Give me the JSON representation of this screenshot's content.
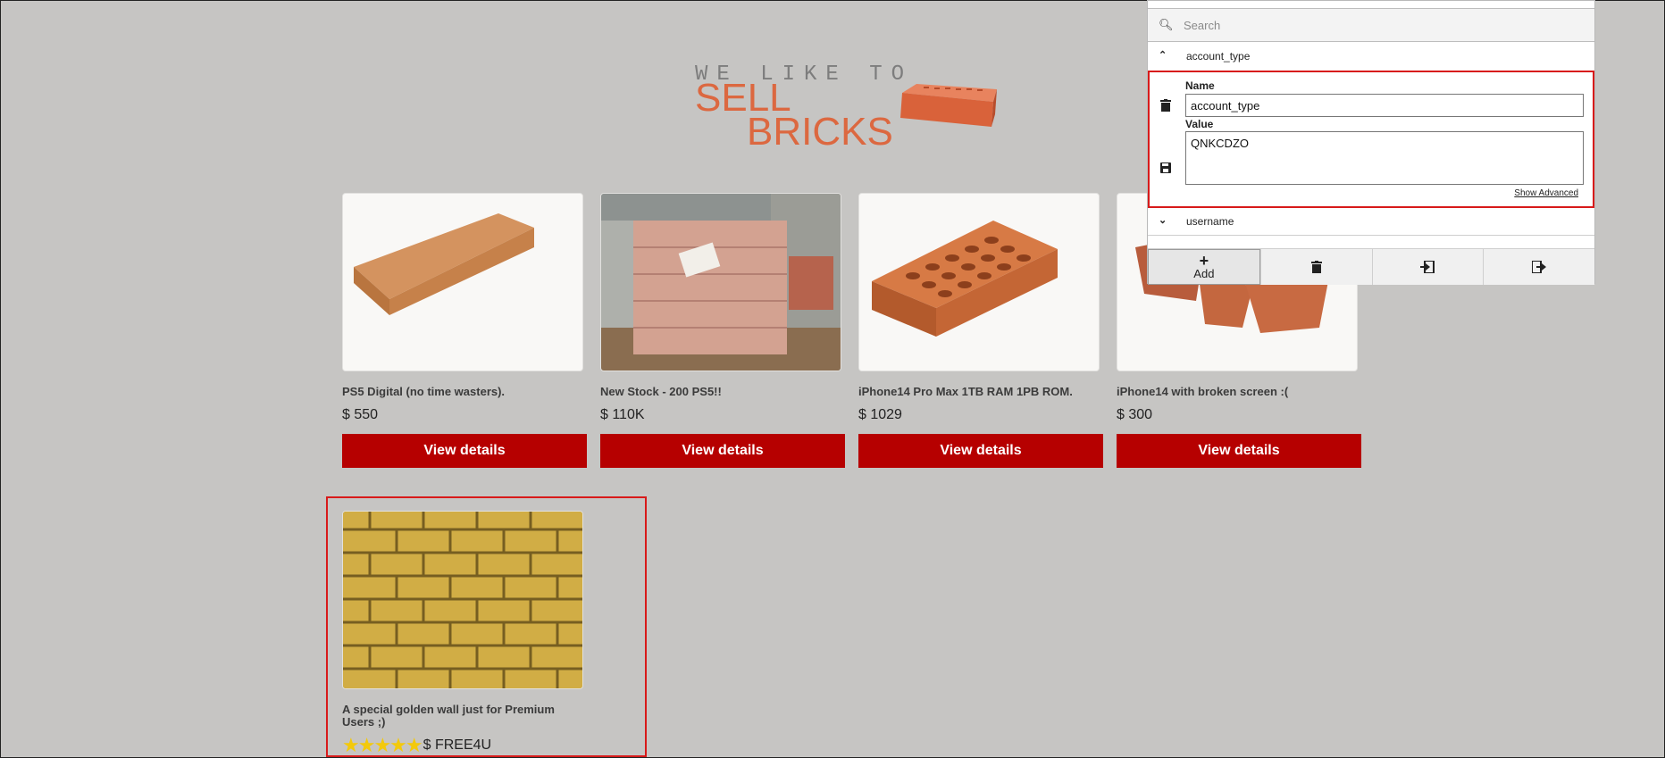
{
  "logo": {
    "tagline": "WE LIKE TO",
    "line1": "SELL",
    "line2": "BRICKS"
  },
  "products": [
    {
      "title": "PS5 Digital (no time wasters).",
      "price": "$ 550",
      "button": "View details"
    },
    {
      "title": "New Stock - 200 PS5!!",
      "price": "$ 110K",
      "button": "View details"
    },
    {
      "title": "iPhone14 Pro Max 1TB RAM 1PB ROM.",
      "price": "$ 1029",
      "button": "View details"
    },
    {
      "title": "iPhone14 with broken screen :(",
      "price": "$ 300",
      "button": "View details"
    }
  ],
  "premium": {
    "title": "A special golden wall just for Premium Users ;)",
    "price": "$ FREE4U",
    "rating": 5
  },
  "cookie_editor": {
    "search_placeholder": "Search",
    "cookies": [
      {
        "name": "account_type",
        "expanded": true
      },
      {
        "name": "username",
        "expanded": false
      }
    ],
    "detail": {
      "name_label": "Name",
      "name_value": "account_type",
      "value_label": "Value",
      "value_value": "QNKCDZO",
      "show_advanced": "Show Advanced"
    },
    "toolbar": {
      "add_label": "Add"
    }
  },
  "colors": {
    "accent": "#b60000",
    "brand": "#dc6840",
    "highlight": "#d81a1a",
    "background": "#c6c5c3"
  }
}
